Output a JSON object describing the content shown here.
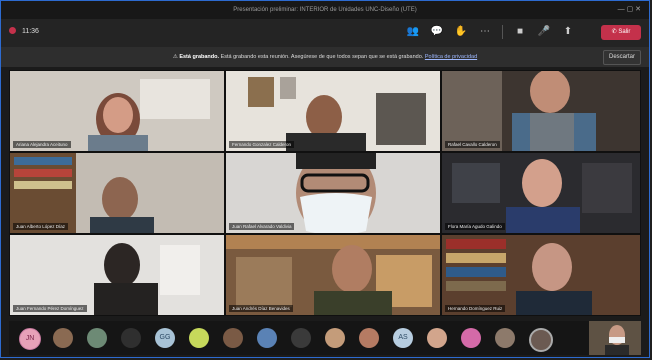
{
  "window": {
    "title": "Presentación preliminar: INTERIOR de Unidades UNC-Diseño (UTE)",
    "timer": "11:36"
  },
  "toolbar": {
    "leave_label": "Salir",
    "icons": [
      "participants-icon",
      "chat-icon",
      "raise-hand-icon",
      "more-icon",
      "camera-icon",
      "mic-icon",
      "share-icon"
    ]
  },
  "banner": {
    "bold": "Está grabando.",
    "text": "Está grabando esta reunión. Asegúrese de que todos sepan que se está grabando.",
    "link": "Política de privacidad",
    "dismiss": "Descartar"
  },
  "participants": [
    {
      "name": "Ariana Alejandra Aceituno"
    },
    {
      "name": "Fernando Gonzalez Calderon"
    },
    {
      "name": "Rafael Cavallo Calderon"
    },
    {
      "name": "Juan Alberto López Díaz"
    },
    {
      "name": "Juan Rafael Alvarado Valdivia"
    },
    {
      "name": "Flora María Agudo Galindo"
    },
    {
      "name": "Juan Fernando Pérez Domínguez"
    },
    {
      "name": "Juan Andrés Díaz Benavides"
    },
    {
      "name": "Hernando Domínguez Ruiz"
    }
  ],
  "tray": {
    "initials": [
      "JN",
      "GG",
      "AS"
    ]
  },
  "colors": {
    "leave": "#c4314b",
    "link": "#9fb9ff",
    "frame_border": "#2d6bd0"
  }
}
